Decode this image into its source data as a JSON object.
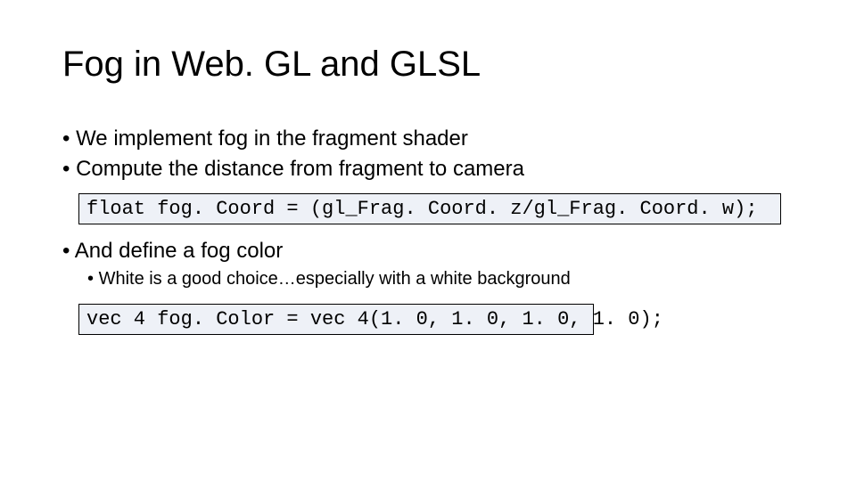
{
  "title": "Fog in Web. GL and GLSL",
  "bullets": {
    "b1": "We implement fog in the fragment shader",
    "b2": "Compute the distance from fragment to camera",
    "b3": "And define a fog color",
    "b3_sub": "White is a good choice…especially with a white background"
  },
  "code": {
    "line1": "float fog. Coord = (gl_Frag. Coord. z/gl_Frag. Coord. w);",
    "line2": "vec 4 fog. Color = vec 4(1. 0, 1. 0, 1. 0, 1. 0);"
  }
}
